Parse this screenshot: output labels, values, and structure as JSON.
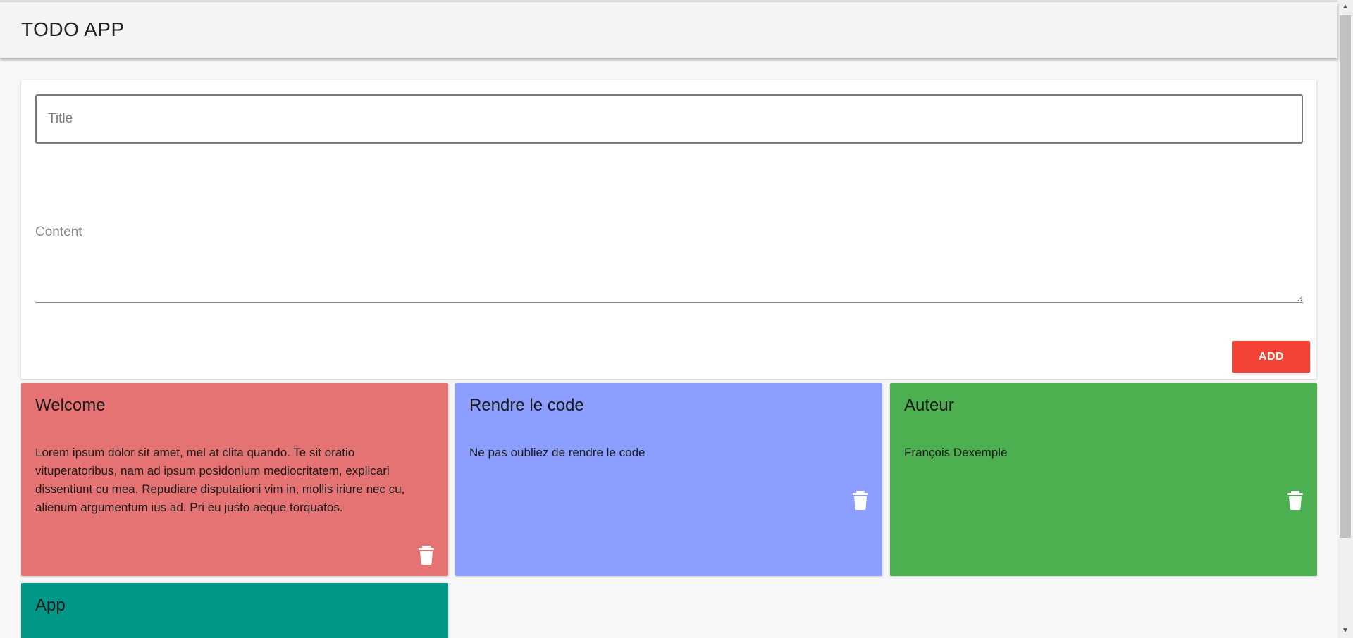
{
  "app": {
    "title": "TODO APP"
  },
  "form": {
    "title_placeholder": "Title",
    "content_placeholder": "Content",
    "add_label": "ADD"
  },
  "colors": {
    "add_button": "#f44336",
    "appbar": "#f4f4f4"
  },
  "notes": [
    {
      "title": "Welcome",
      "content": "Lorem ipsum dolor sit amet, mel at clita quando. Te sit oratio vituperatoribus, nam ad ipsum posidonium mediocritatem, explicari dissentiunt cu mea. Repudiare disputationi vim in, mollis iriure nec cu, alienum argumentum ius ad. Pri eu justo aeque torquatos.",
      "color": "#e57373",
      "delete_icon": "trash-icon"
    },
    {
      "title": "Rendre le code",
      "content": "Ne pas oubliez de rendre le code",
      "color": "#8c9eff",
      "delete_icon": "trash-icon"
    },
    {
      "title": "Auteur",
      "content": "François Dexemple",
      "color": "#4caf50",
      "delete_icon": "trash-icon"
    },
    {
      "title": "App",
      "content": "",
      "color": "#009688",
      "delete_icon": "trash-icon"
    }
  ]
}
